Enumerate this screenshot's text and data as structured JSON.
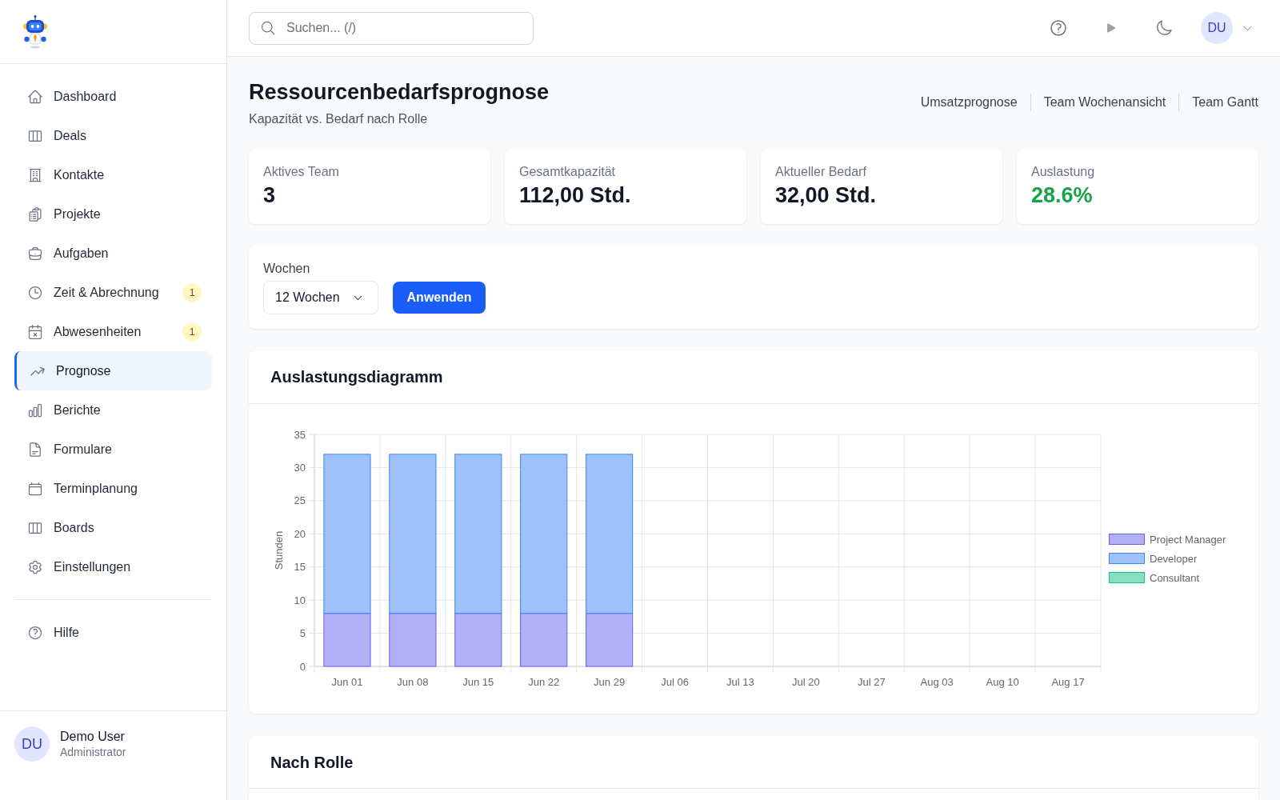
{
  "sidebar": {
    "nav_items": [
      {
        "label": "Dashboard",
        "selected": false
      },
      {
        "label": "Deals",
        "selected": false
      },
      {
        "label": "Kontakte",
        "selected": false
      },
      {
        "label": "Projekte",
        "selected": false
      },
      {
        "label": "Aufgaben",
        "selected": false
      },
      {
        "label": "Zeit & Abrechnung",
        "badge": "1",
        "selected": false
      },
      {
        "label": "Abwesenheiten",
        "badge": "1",
        "selected": false
      },
      {
        "label": "Prognose",
        "selected": true
      },
      {
        "label": "Berichte",
        "selected": false
      },
      {
        "label": "Formulare",
        "selected": false
      },
      {
        "label": "Terminplanung",
        "selected": false
      },
      {
        "label": "Boards",
        "selected": false
      },
      {
        "label": "Einstellungen",
        "selected": false
      }
    ],
    "secondary_items": [
      {
        "label": "Hilfe",
        "selected": false
      }
    ],
    "user": {
      "initials": "DU",
      "name": "Demo User",
      "role": "Administrator"
    }
  },
  "header": {
    "search": {
      "placeholder": "Suchen... (/)"
    },
    "user_initials": "DU"
  },
  "page": {
    "title": "Ressourcenbedarfsprognose",
    "subtitle": "Kapazität vs. Bedarf nach Rolle",
    "links": [
      "Umsatzprognose",
      "Team Wochenansicht",
      "Team Gantt"
    ]
  },
  "stats": [
    {
      "label": "Aktives Team",
      "value": "3",
      "kind": "plain"
    },
    {
      "label": "Gesamtkapazität",
      "value": "112,00 Std.",
      "kind": "plain"
    },
    {
      "label": "Aktueller Bedarf",
      "value": "32,00 Std.",
      "kind": "plain"
    },
    {
      "label": "Auslastung",
      "value": "28.6%",
      "kind": "positive"
    }
  ],
  "filter": {
    "label": "Wochen",
    "select_value": "12 Wochen",
    "button": "Anwenden"
  },
  "utilization_chart": {
    "title": "Auslastungsdiagramm",
    "chart_data": {
      "type": "bar",
      "stacked": true,
      "grid": true,
      "legend": true,
      "ylabel": "Stunden",
      "categories": [
        "Jun 01",
        "Jun 08",
        "Jun 15",
        "Jun 22",
        "Jun 29",
        "Jul 06",
        "Jul 13",
        "Jul 20",
        "Jul 27",
        "Aug 03",
        "Aug 10",
        "Aug 17"
      ],
      "ylim": [
        0,
        35
      ],
      "yticks": [
        0,
        5,
        10,
        15,
        20,
        25,
        30,
        35
      ],
      "series": [
        {
          "name": "Project Manager",
          "color": "#b2b0f6",
          "values": [
            8,
            8,
            8,
            8,
            8,
            0,
            0,
            0,
            0,
            0,
            0,
            0
          ]
        },
        {
          "name": "Developer",
          "color": "#9fc2fa",
          "values": [
            24,
            24,
            24,
            24,
            24,
            0,
            0,
            0,
            0,
            0,
            0,
            0
          ]
        },
        {
          "name": "Consultant",
          "color": "#88e0c3",
          "values": [
            0,
            0,
            0,
            0,
            0,
            0,
            0,
            0,
            0,
            0,
            0,
            0
          ]
        }
      ]
    }
  },
  "role_section": {
    "title": "Nach Rolle"
  }
}
